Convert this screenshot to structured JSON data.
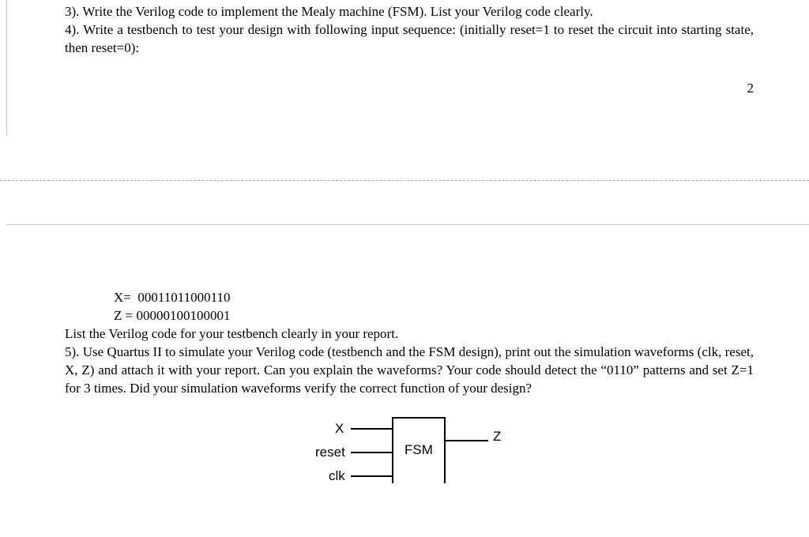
{
  "q3": "3). Write the Verilog code to implement the Mealy machine (FSM). List your Verilog code clearly.",
  "q4": "4). Write a testbench to test your design with following input sequence: (initially reset=1 to reset the circuit into starting state, then reset=0):",
  "page_number": "2",
  "x_line": "X=  00011011000110",
  "z_line": "Z = 00000100100001",
  "tb_note": "List the Verilog code for your testbench clearly in your report.",
  "q5": "5). Use Quartus II to simulate your Verilog code (testbench and the FSM design), print out the simulation waveforms (clk, reset, X, Z) and attach it with your report. Can you explain the waveforms? Your code should detect the “0110” patterns and set Z=1 for 3 times. Did your simulation waveforms verify the correct function of your design?",
  "diagram": {
    "x": "X",
    "reset": "reset",
    "clk": "clk",
    "z": "Z",
    "box": "FSM"
  }
}
